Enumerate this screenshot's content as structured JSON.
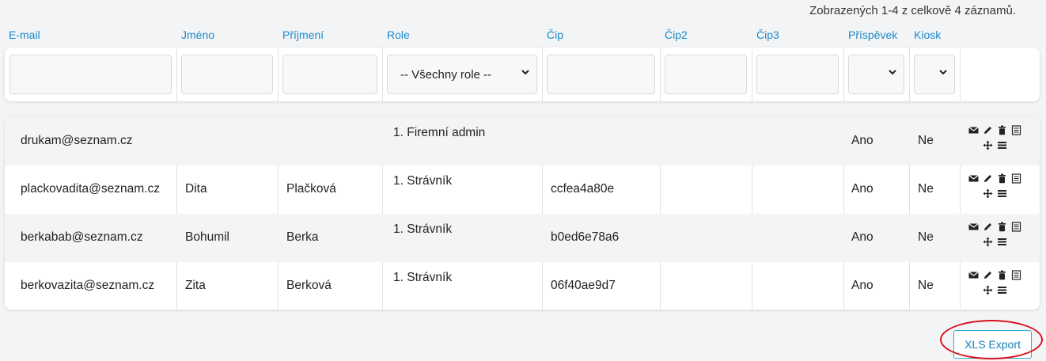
{
  "summary": "Zobrazených 1-4 z celkově 4 záznamů.",
  "columns": {
    "email": "E-mail",
    "jmeno": "Jméno",
    "prijmeni": "Příjmení",
    "role": "Role",
    "cip": "Čip",
    "cip2": "Čip2",
    "cip3": "Čip3",
    "prispevek": "Příspěvek",
    "kiosk": "Kiosk"
  },
  "filters": {
    "role_select": "-- Všechny role --",
    "email_value": "",
    "jmeno_value": "",
    "prijmeni_value": "",
    "cip_value": "",
    "cip2_value": "",
    "cip3_value": "",
    "prispevek_value": "",
    "kiosk_value": ""
  },
  "rows": [
    {
      "email": "drukam@seznam.cz",
      "jmeno": "",
      "prijmeni": "",
      "role": "1. Firemní admin",
      "cip": "",
      "cip2": "",
      "cip3": "",
      "prispevek": "Ano",
      "kiosk": "Ne"
    },
    {
      "email": "plackovadita@seznam.cz",
      "jmeno": "Dita",
      "prijmeni": "Plačková",
      "role": "1. Strávník",
      "cip": "ccfea4a80e",
      "cip2": "",
      "cip3": "",
      "prispevek": "Ano",
      "kiosk": "Ne"
    },
    {
      "email": "berkabab@seznam.cz",
      "jmeno": "Bohumil",
      "prijmeni": "Berka",
      "role": "1. Strávník",
      "cip": "b0ed6e78a6",
      "cip2": "",
      "cip3": "",
      "prispevek": "Ano",
      "kiosk": "Ne"
    },
    {
      "email": "berkovazita@seznam.cz",
      "jmeno": "Zita",
      "prijmeni": "Berková",
      "role": "1. Strávník",
      "cip": "06f40ae9d7",
      "cip2": "",
      "cip3": "",
      "prispevek": "Ano",
      "kiosk": "Ne"
    }
  ],
  "row_action_icons": [
    "envelope-icon",
    "pencil-icon",
    "trash-icon",
    "list-icon",
    "move-icon",
    "menu-icon"
  ],
  "export_button": "XLS Export",
  "colors": {
    "link": "#1a8ac8",
    "highlight": "#d8121e",
    "button_border": "#36a6d6"
  }
}
